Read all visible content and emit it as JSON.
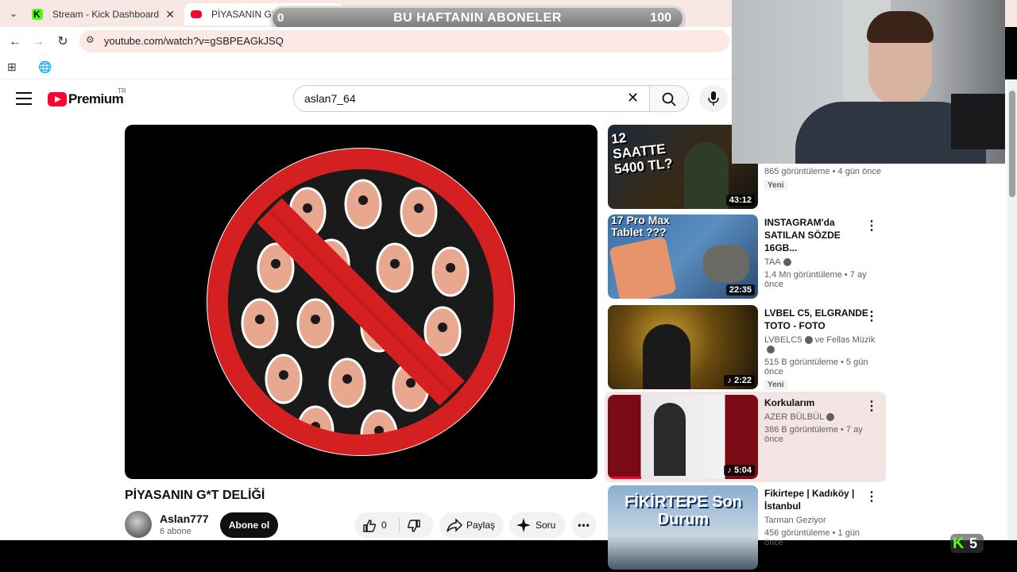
{
  "browser": {
    "tabs": [
      {
        "title": "Stream - Kick Dashboard",
        "active": false
      },
      {
        "title": "PİYASANIN G*T DELİĞİ - You",
        "active": true
      }
    ],
    "url": "youtube.com/watch?v=gSBPEAGkJSQ"
  },
  "overlay": {
    "left_num": "0",
    "title": "BU HAFTANIN ABONELER",
    "count": "100"
  },
  "youtube": {
    "logo": "Premium",
    "region": "TR",
    "search_query": "aslan7_64"
  },
  "video": {
    "title": "PİYASANIN G*T DELİĞİ",
    "channel": "Aslan777",
    "subscribers": "6 abone",
    "subscribe_label": "Abone ol",
    "likes": "0",
    "share_label": "Paylaş",
    "ask_label": "Soru"
  },
  "recommendations": [
    {
      "thumb_text": "12 SAATTE 5400 TL?",
      "duration": "43:12",
      "meta": "865 görüntüleme • 4 gün önce",
      "badge": "Yeni"
    },
    {
      "thumb_text": "17 Pro Max Tablet ???",
      "duration": "22:35",
      "title": "INSTAGRAM'da SATILAN SÖZDE 16GB...",
      "channel": "TAA",
      "meta": "1,4 Mn görüntüleme • 7 ay önce"
    },
    {
      "duration": "2:22",
      "title": "LVBEL C5, ELGRANDE TOTO - FOTO",
      "channel": "LVBELC5",
      "channel2": "ve Fellas Müzik",
      "meta": "515 B görüntüleme • 5 gün önce",
      "badge": "Yeni"
    },
    {
      "duration": "5:04",
      "title": "Korkularım",
      "channel": "AZER BÜLBÜL",
      "meta": "386 B görüntüleme • 7 ay önce"
    },
    {
      "thumb_text": "FİKİRTEPE Son Durum",
      "title": "Fikirtepe | Kadıköy | İstanbul",
      "channel": "Tarman Geziyor",
      "meta": "456 görüntüleme • 1 gün önce"
    }
  ],
  "kick_badge": {
    "count": "5"
  },
  "colors": {
    "yt_red": "#ff0033",
    "kick_green": "#53fc18",
    "highlight_row": "#f4e4e4"
  }
}
